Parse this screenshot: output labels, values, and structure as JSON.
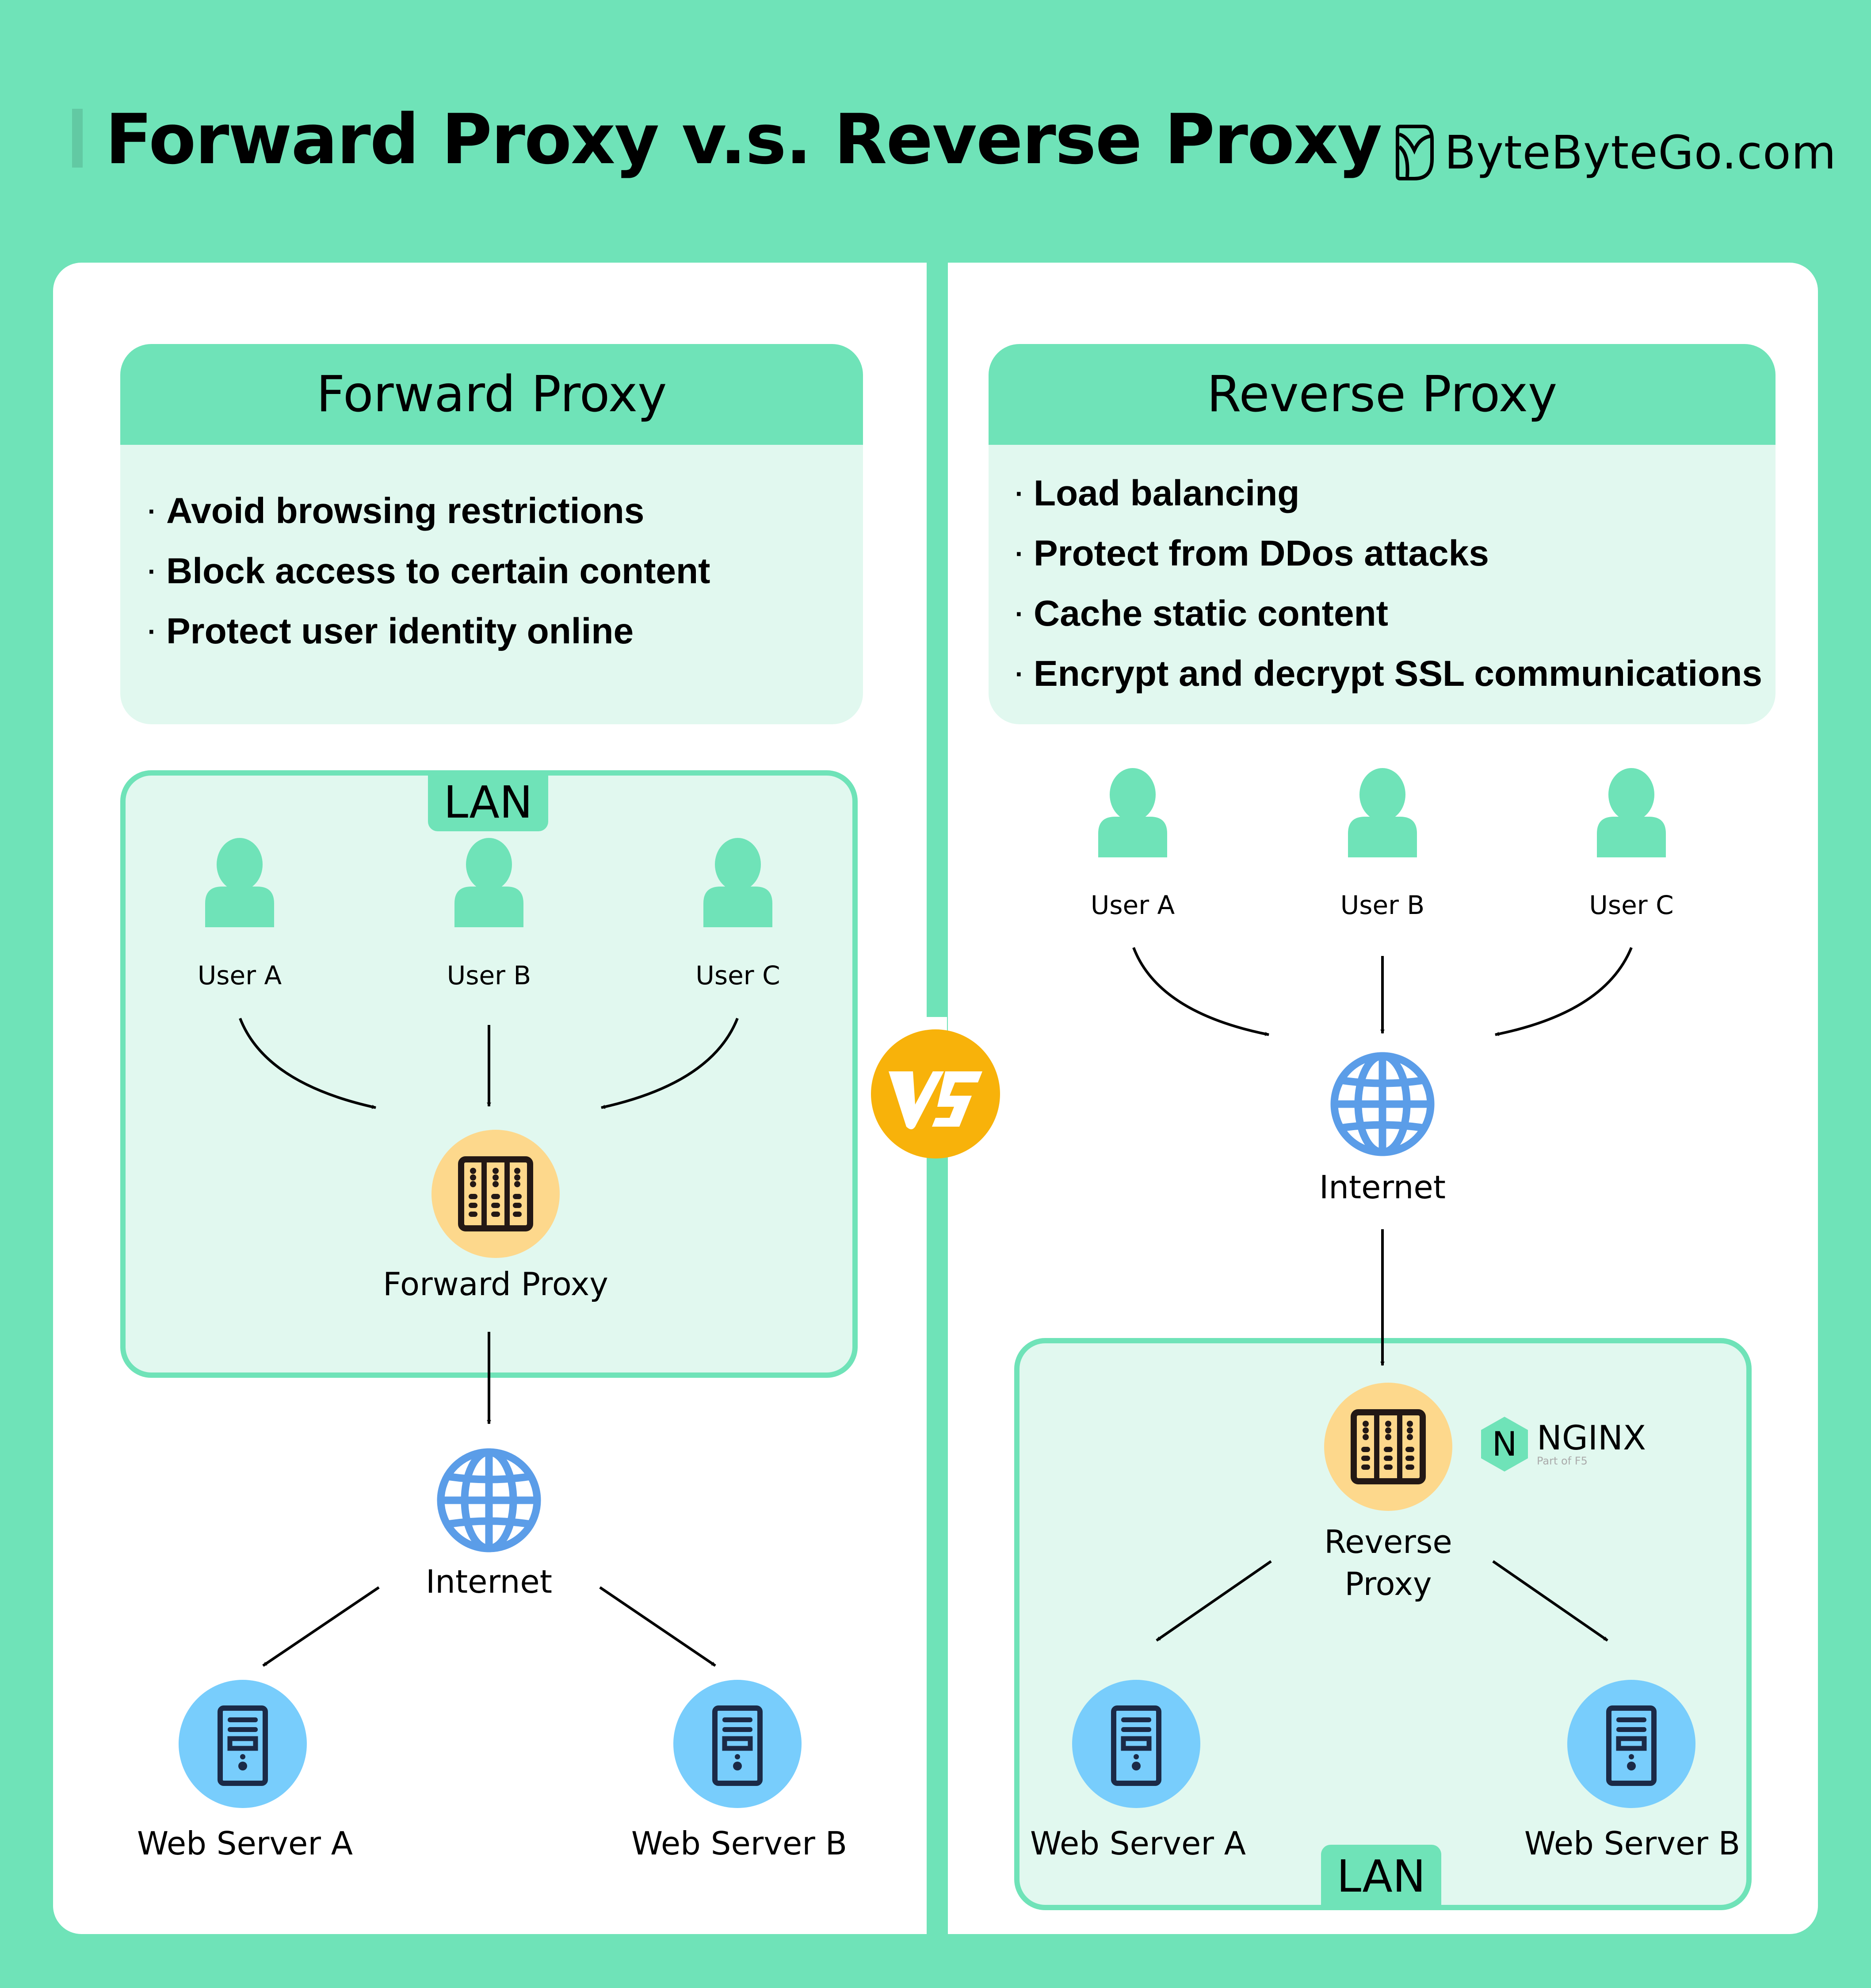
{
  "header": {
    "title": "Forward Proxy v.s. Reverse Proxy",
    "brand": "ByteByteGo.com",
    "brand_icon": "bytebytego-logo-icon"
  },
  "colors": {
    "background": "#6fe3b8",
    "card_body": "#e1f8ef",
    "panel": "#ffffff",
    "user_icon": "#6fe3b8",
    "proxy_circle": "#fdd88c",
    "proxy_icon": "#231815",
    "globe": "#5b9de8",
    "server_circle": "#78cdfc",
    "server_icon": "#1b2a47",
    "vs_badge": "#f8b20a",
    "arrow": "#000000"
  },
  "vs_badge": {
    "label": "VS"
  },
  "forward_proxy": {
    "heading": "Forward Proxy",
    "bullet_symbol": "·",
    "bullets": [
      "Avoid browsing restrictions",
      "Block access to certain content",
      "Protect user identity online"
    ],
    "diagram": {
      "lan_label": "LAN",
      "users": [
        "User A",
        "User B",
        "User C"
      ],
      "proxy_label": "Forward Proxy",
      "internet_label": "Internet",
      "servers": [
        "Web Server A",
        "Web Server B"
      ]
    }
  },
  "reverse_proxy": {
    "heading": "Reverse Proxy",
    "bullet_symbol": "·",
    "bullets": [
      "Load balancing",
      "Protect from DDos attacks",
      "Cache static content",
      "Encrypt and decrypt SSL communications"
    ],
    "diagram": {
      "users": [
        "User A",
        "User B",
        "User C"
      ],
      "internet_label": "Internet",
      "proxy_label_line1": "Reverse",
      "proxy_label_line2": "Proxy",
      "nginx": {
        "letter": "N",
        "name": "NGINX",
        "subtitle": "Part of F5"
      },
      "lan_label": "LAN",
      "servers": [
        "Web Server A",
        "Web Server B"
      ]
    }
  }
}
